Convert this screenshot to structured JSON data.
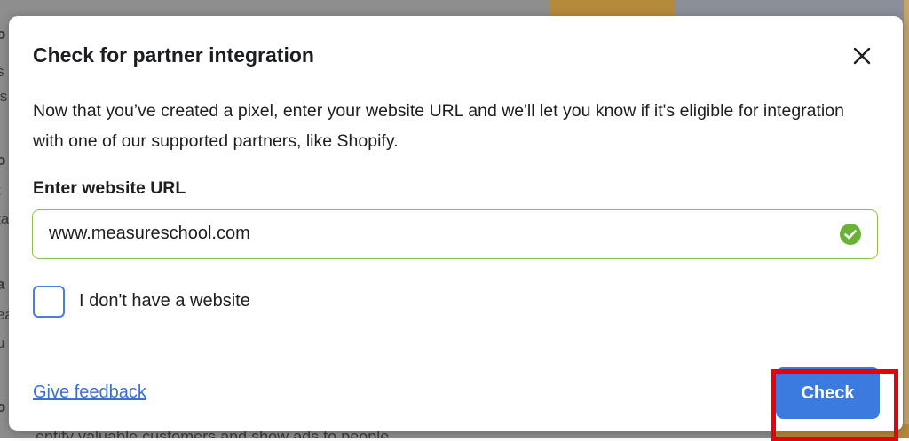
{
  "dialog": {
    "title": "Check for partner integration",
    "description": "Now that you’ve created a pixel, enter your website URL and we'll let you know if it's eligible for integration with one of our supported partners, like Shopify.",
    "url_label": "Enter website URL",
    "url_value": "www.measureschool.com",
    "no_website_label": "I don't have a website",
    "no_website_checked": false,
    "feedback_link": "Give feedback",
    "check_button": "Check"
  },
  "background": {
    "bottom_text": "entify valuable customers and show ads to people",
    "left_fragments": [
      "o",
      "s",
      "ls",
      "o",
      "t",
      "ta",
      "a",
      "ea",
      "u",
      "o"
    ]
  },
  "colors": {
    "accent": "#3b7be0",
    "valid_border": "#8bc34a",
    "highlight": "#e8000b",
    "link": "#3b6fd4"
  },
  "icons": {
    "close": "close-icon",
    "valid": "check-circle-icon"
  }
}
